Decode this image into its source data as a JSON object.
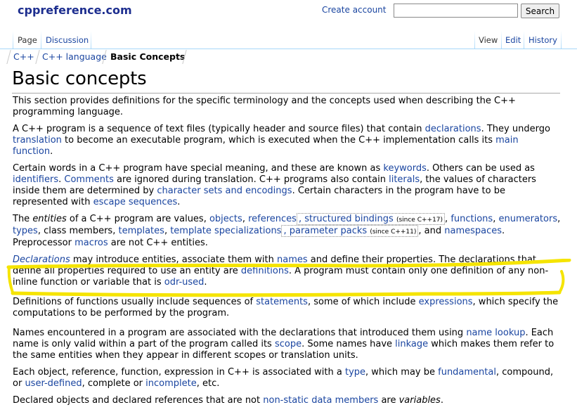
{
  "site": {
    "logo": "cppreference.com",
    "create_account": "Create account"
  },
  "search": {
    "placeholder": "",
    "button": "Search"
  },
  "tabs": {
    "page": "Page",
    "discussion": "Discussion",
    "view": "View",
    "edit": "Edit",
    "history": "History"
  },
  "breadcrumb": [
    "C++",
    "C++ language",
    "Basic Concepts"
  ],
  "title": "Basic concepts",
  "highlight_color": "#f5e400",
  "link_color": "#1a45a0",
  "p1": {
    "t": "This section provides definitions for the specific terminology and the concepts used when describing the C++ programming language."
  },
  "p2": {
    "t1": "A C++ program is a sequence of text files (typically header and source files) that contain ",
    "l1": "declarations",
    "t2": ". They undergo ",
    "l2": "translation",
    "t3": " to become an executable program, which is executed when the C++ implementation calls its ",
    "l3": "main function",
    "t4": "."
  },
  "p3": {
    "t1": "Certain words in a C++ program have special meaning, and these are known as ",
    "l1": "keywords",
    "t2": ". Others can be used as ",
    "l2": "identifiers",
    "t3": ". ",
    "l3": "Comments",
    "t4": " are ignored during translation. C++ programs also contain ",
    "l4": "literals",
    "t5": ", the values of characters inside them are determined by ",
    "l5": "character sets and encodings",
    "t6": ". Certain characters in the program have to be represented with ",
    "l6": "escape sequences",
    "t7": "."
  },
  "p4": {
    "t1": "The ",
    "e1": "entities",
    "t2": " of a C++ program are values, ",
    "l1": "objects",
    "t3": ", ",
    "l2": "references",
    "l3": ", structured bindings",
    "s1": "(since C++17)",
    "t4": ", ",
    "l4": "functions",
    "t5": ", ",
    "l5": "enumerators",
    "t6": ", ",
    "l6": "types",
    "t7": ", class members, ",
    "l7": "templates",
    "t8": ", ",
    "l8": "template specializations",
    "l9": ", parameter packs",
    "s2": "(since C++11)",
    "t9": ", and ",
    "l10": "namespaces",
    "t10": ". Preprocessor ",
    "l11": "macros",
    "t11": " are not C++ entities."
  },
  "p5": {
    "e1": "Declarations",
    "t1": " may introduce entities, associate them with ",
    "l1": "names",
    "t2": " and define their properties. The declarations that define all properties required to use an entity are ",
    "l2": "definitions",
    "t3": ". A program must contain only one definition of any non-inline function or variable that is ",
    "l3": "odr-used",
    "t4": "."
  },
  "p6": {
    "t1": "Definitions of functions usually include sequences of ",
    "l1": "statements",
    "t2": ", some of which include ",
    "l2": "expressions",
    "t3": ", which specify the computations to be performed by the program."
  },
  "p7": {
    "t1": "Names encountered in a program are associated with the declarations that introduced them using ",
    "l1": "name lookup",
    "t2": ". Each name is only valid within a part of the program called its ",
    "l2": "scope",
    "t3": ". Some names have ",
    "l3": "linkage",
    "t4": " which makes them refer to the same entities when they appear in different scopes or translation units."
  },
  "p8": {
    "t1": "Each object, reference, function, expression in C++ is associated with a ",
    "l1": "type",
    "t2": ", which may be ",
    "l2": "fundamental",
    "t3": ", compound, or ",
    "l3": "user-defined",
    "t4": ", complete or ",
    "l4": "incomplete",
    "t5": ", etc."
  },
  "p9": {
    "t1": "Declared objects and declared references that are not ",
    "l1": "non-static data members",
    "t2": " are ",
    "e1": "variables",
    "t3": "."
  }
}
